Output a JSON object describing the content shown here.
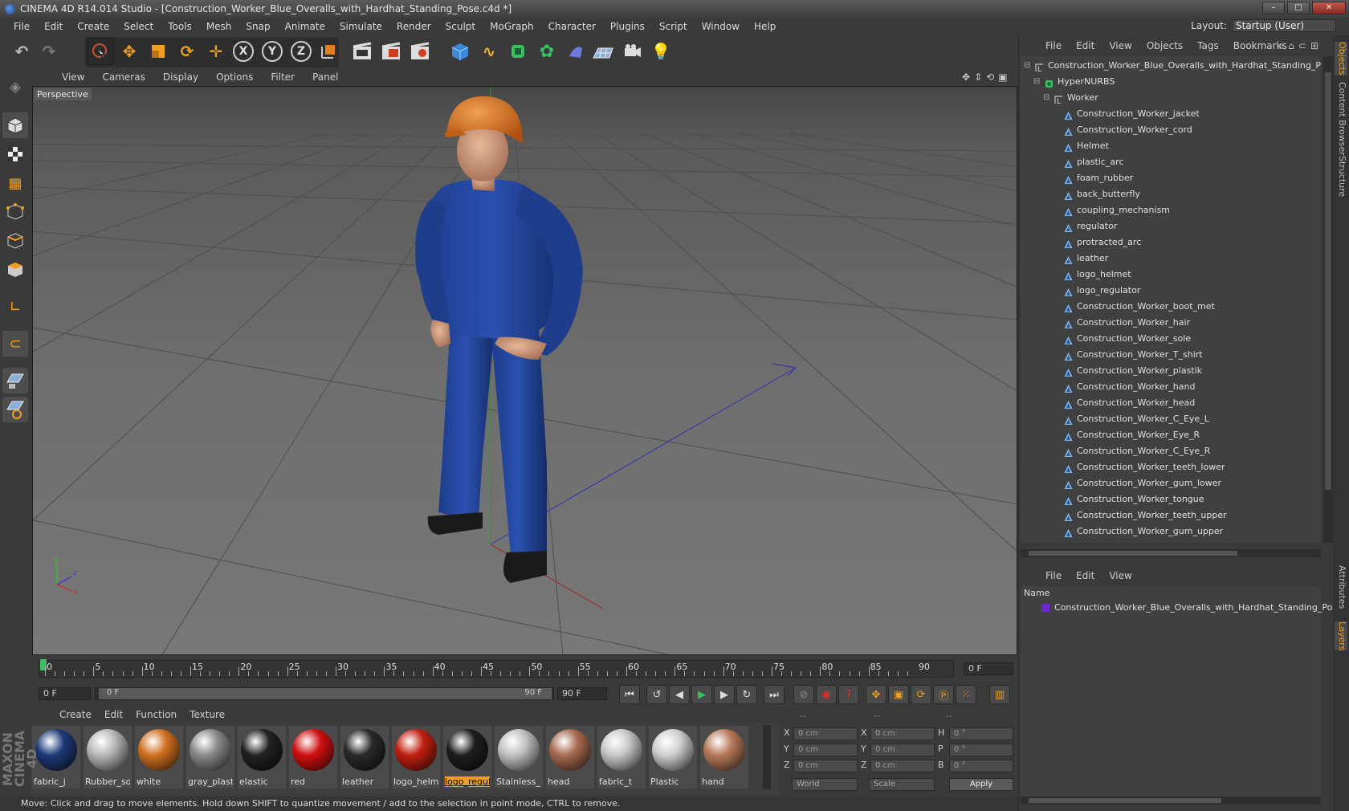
{
  "window": {
    "title": "CINEMA 4D R14.014 Studio - [Construction_Worker_Blue_Overalls_with_Hardhat_Standing_Pose.c4d *]",
    "buttons": [
      "–",
      "□",
      "✕"
    ]
  },
  "menubar": {
    "items": [
      "File",
      "Edit",
      "Create",
      "Select",
      "Tools",
      "Mesh",
      "Snap",
      "Animate",
      "Simulate",
      "Render",
      "Sculpt",
      "MoGraph",
      "Character",
      "Plugins",
      "Script",
      "Window",
      "Help"
    ],
    "layout_label": "Layout:",
    "layout_value": "Startup (User)"
  },
  "toolbar": {
    "axis_x": "X",
    "axis_y": "Y",
    "axis_z": "Z"
  },
  "viewport": {
    "menu": [
      "View",
      "Cameras",
      "Display",
      "Options",
      "Filter",
      "Panel"
    ],
    "label": "Perspective"
  },
  "timeline": {
    "ticks": [
      "0",
      "5",
      "10",
      "15",
      "20",
      "25",
      "30",
      "35",
      "40",
      "45",
      "50",
      "55",
      "60",
      "65",
      "70",
      "75",
      "80",
      "85",
      "90"
    ],
    "current_frame": "0 F"
  },
  "transport": {
    "start_field": "0 F",
    "range_start": "0 F",
    "range_end": "90 F",
    "end_field": "90 F"
  },
  "materials": {
    "menu": [
      "Create",
      "Edit",
      "Function",
      "Texture"
    ],
    "items": [
      {
        "label": "fabric_j",
        "color": "#1e3a78"
      },
      {
        "label": "Rubber_so",
        "color": "#b8b8b8"
      },
      {
        "label": "white",
        "color": "#d07020"
      },
      {
        "label": "gray_plasti",
        "color": "#8a8a8a"
      },
      {
        "label": "elastic",
        "color": "#222222"
      },
      {
        "label": "red",
        "color": "#d01010"
      },
      {
        "label": "leather",
        "color": "#2a2a2a"
      },
      {
        "label": "logo_helm",
        "color": "#c02010"
      },
      {
        "label": "logo_regul",
        "color": "#1e1e1e",
        "active": true
      },
      {
        "label": "Stainless_",
        "color": "#c0c0c0"
      },
      {
        "label": "head",
        "color": "#a86a50"
      },
      {
        "label": "fabric_t",
        "color": "#c8c8c8"
      },
      {
        "label": "Plastic",
        "color": "#cfcfcf"
      },
      {
        "label": "hand",
        "color": "#b87a5a"
      }
    ]
  },
  "coords": {
    "headers": [
      "--",
      "--",
      "--"
    ],
    "rows": [
      {
        "a": "X",
        "av": "0 cm",
        "b": "X",
        "bv": "0 cm",
        "c": "H",
        "cv": "0 °"
      },
      {
        "a": "Y",
        "av": "0 cm",
        "b": "Y",
        "bv": "0 cm",
        "c": "P",
        "cv": "0 °"
      },
      {
        "a": "Z",
        "av": "0 cm",
        "b": "Z",
        "bv": "0 cm",
        "c": "B",
        "cv": "0 °"
      }
    ],
    "mode1": "World",
    "mode2": "Scale",
    "apply": "Apply"
  },
  "status": "Move: Click and drag to move elements. Hold down SHIFT to quantize movement / add to the selection in point mode, CTRL to remove.",
  "brand": "MAXON CINEMA 4D",
  "objects": {
    "menu": [
      "File",
      "Edit",
      "View",
      "Objects",
      "Tags",
      "Bookmarks"
    ],
    "tree": [
      {
        "label": "Construction_Worker_Blue_Overalls_with_Hardhat_Standing_Pos",
        "level": 0,
        "icon": "null"
      },
      {
        "label": "HyperNURBS",
        "level": 1,
        "icon": "nurbs"
      },
      {
        "label": "Worker",
        "level": 2,
        "icon": "null"
      },
      {
        "label": "Construction_Worker_jacket",
        "level": 3,
        "icon": "poly"
      },
      {
        "label": "Construction_Worker_cord",
        "level": 3,
        "icon": "poly"
      },
      {
        "label": "Helmet",
        "level": 3,
        "icon": "poly"
      },
      {
        "label": "plastic_arc",
        "level": 3,
        "icon": "poly"
      },
      {
        "label": "foam_rubber",
        "level": 3,
        "icon": "poly"
      },
      {
        "label": "back_butterfly",
        "level": 3,
        "icon": "poly"
      },
      {
        "label": "coupling_mechanism",
        "level": 3,
        "icon": "poly"
      },
      {
        "label": "regulator",
        "level": 3,
        "icon": "poly"
      },
      {
        "label": "protracted_arc",
        "level": 3,
        "icon": "poly"
      },
      {
        "label": "leather",
        "level": 3,
        "icon": "poly"
      },
      {
        "label": "logo_helmet",
        "level": 3,
        "icon": "poly"
      },
      {
        "label": "logo_regulator",
        "level": 3,
        "icon": "poly"
      },
      {
        "label": "Construction_Worker_boot_met",
        "level": 3,
        "icon": "poly"
      },
      {
        "label": "Construction_Worker_hair",
        "level": 3,
        "icon": "poly"
      },
      {
        "label": "Construction_Worker_sole",
        "level": 3,
        "icon": "poly"
      },
      {
        "label": "Construction_Worker_T_shirt",
        "level": 3,
        "icon": "poly"
      },
      {
        "label": "Construction_Worker_plastik",
        "level": 3,
        "icon": "poly"
      },
      {
        "label": "Construction_Worker_hand",
        "level": 3,
        "icon": "poly"
      },
      {
        "label": "Construction_Worker_head",
        "level": 3,
        "icon": "poly"
      },
      {
        "label": "Construction_Worker_C_Eye_L",
        "level": 3,
        "icon": "poly"
      },
      {
        "label": "Construction_Worker_Eye_R",
        "level": 3,
        "icon": "poly"
      },
      {
        "label": "Construction_Worker_C_Eye_R",
        "level": 3,
        "icon": "poly"
      },
      {
        "label": "Construction_Worker_teeth_lower",
        "level": 3,
        "icon": "poly"
      },
      {
        "label": "Construction_Worker_gum_lower",
        "level": 3,
        "icon": "poly"
      },
      {
        "label": "Construction_Worker_tongue",
        "level": 3,
        "icon": "poly"
      },
      {
        "label": "Construction_Worker_teeth_upper",
        "level": 3,
        "icon": "poly"
      },
      {
        "label": "Construction_Worker_gum_upper",
        "level": 3,
        "icon": "poly"
      }
    ]
  },
  "layers": {
    "menu": [
      "File",
      "Edit",
      "View"
    ],
    "header": "Name",
    "items": [
      {
        "label": "Construction_Worker_Blue_Overalls_with_Hardhat_Standing_Pose",
        "color": "#6a2ad0"
      }
    ]
  },
  "sidetabs": [
    "Objects",
    "Content Browser",
    "Structure",
    "Attributes",
    "Layers"
  ]
}
